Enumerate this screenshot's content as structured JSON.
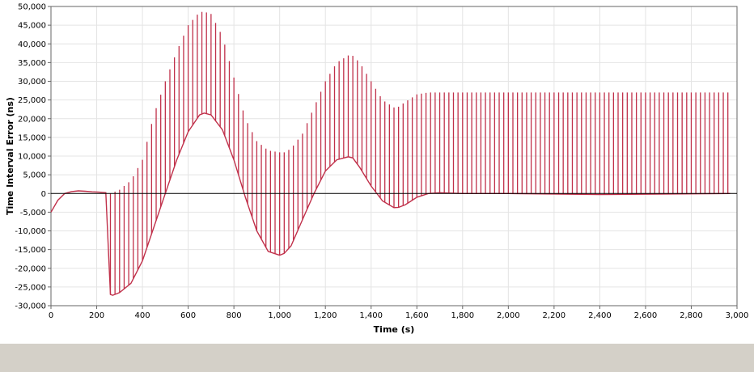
{
  "chart_data": {
    "type": "line",
    "title": "",
    "xlabel": "Time (s)",
    "ylabel": "Time Interval Error (ns)",
    "xlim": [
      0,
      3000
    ],
    "ylim": [
      -30000,
      50000
    ],
    "x_ticks": [
      "0",
      "200",
      "400",
      "600",
      "800",
      "1,000",
      "1,200",
      "1,400",
      "1,600",
      "1,800",
      "2,000",
      "2,200",
      "2,400",
      "2,600",
      "2,800",
      "3,000"
    ],
    "y_ticks": [
      "-30,000",
      "-25,000",
      "-20,000",
      "-15,000",
      "-10,000",
      "-5,000",
      "0",
      "5,000",
      "10,000",
      "15,000",
      "20,000",
      "25,000",
      "30,000",
      "35,000",
      "40,000",
      "45,000",
      "50,000"
    ],
    "grid": true,
    "legend": "none",
    "line_color": "#c0304a",
    "series": [
      {
        "values_note": "",
        "lower_envelope": {
          "x": [
            0,
            30,
            60,
            90,
            120,
            150,
            180,
            210,
            240,
            260,
            270,
            300,
            350,
            400,
            450,
            500,
            550,
            600,
            650,
            670,
            700,
            750,
            800,
            850,
            900,
            950,
            1000,
            1020,
            1050,
            1100,
            1150,
            1200,
            1250,
            1300,
            1320,
            1350,
            1400,
            1450,
            1500,
            1520,
            1550,
            1600,
            1650,
            1700,
            1800,
            2000,
            2400,
            2970
          ],
          "y": [
            -5000,
            -1800,
            0,
            500,
            700,
            600,
            450,
            350,
            200,
            -27000,
            -27200,
            -26500,
            -24000,
            -18000,
            -9000,
            0,
            9000,
            16500,
            21000,
            21500,
            21000,
            17000,
            9000,
            -1000,
            -10000,
            -15500,
            -16500,
            -16000,
            -14000,
            -7000,
            0,
            6000,
            9000,
            9800,
            9500,
            7000,
            2000,
            -2000,
            -3800,
            -3700,
            -3000,
            -1000,
            0,
            200,
            0,
            0,
            -300,
            0
          ]
        },
        "upper_envelope": {
          "x": [
            260,
            300,
            350,
            400,
            450,
            500,
            550,
            600,
            650,
            670,
            700,
            750,
            800,
            850,
            900,
            950,
            1000,
            1020,
            1050,
            1100,
            1150,
            1200,
            1250,
            1300,
            1320,
            1350,
            1400,
            1450,
            1500,
            1520,
            1550,
            1600,
            1650,
            1700,
            1800,
            2000,
            2400,
            2970
          ],
          "y": [
            0,
            1000,
            3500,
            9000,
            21000,
            30000,
            38000,
            45000,
            48500,
            48600,
            48000,
            42000,
            31000,
            20000,
            14000,
            11500,
            11000,
            11000,
            12000,
            16000,
            23000,
            30000,
            35000,
            36900,
            36800,
            35000,
            30000,
            25000,
            23000,
            23200,
            24500,
            26500,
            27000,
            27000,
            27000,
            27000,
            27000,
            27000
          ]
        },
        "bar_interval": 20,
        "bar_start": 260,
        "bar_end": 2970
      }
    ]
  }
}
